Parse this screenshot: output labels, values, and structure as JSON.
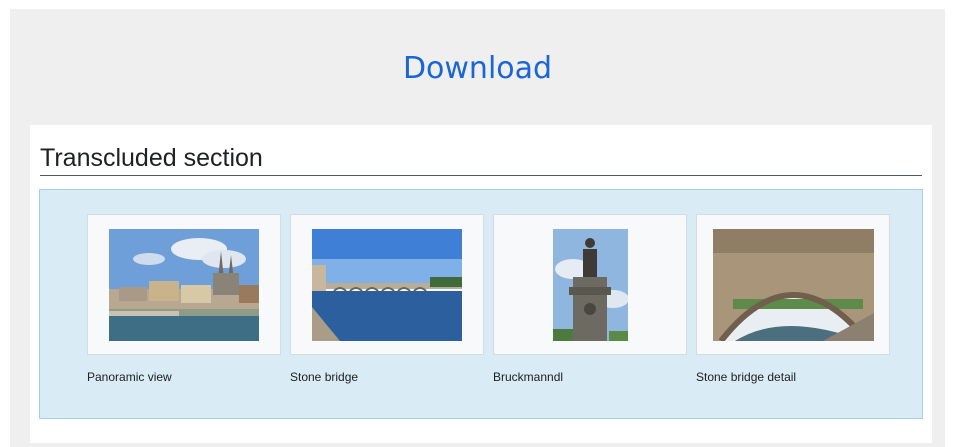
{
  "header": {
    "download_label": "Download"
  },
  "section": {
    "title": "Transcluded section"
  },
  "gallery": {
    "items": [
      {
        "caption": "Panoramic view"
      },
      {
        "caption": "Stone bridge"
      },
      {
        "caption": "Bruckmanndl"
      },
      {
        "caption": "Stone bridge detail"
      }
    ]
  }
}
